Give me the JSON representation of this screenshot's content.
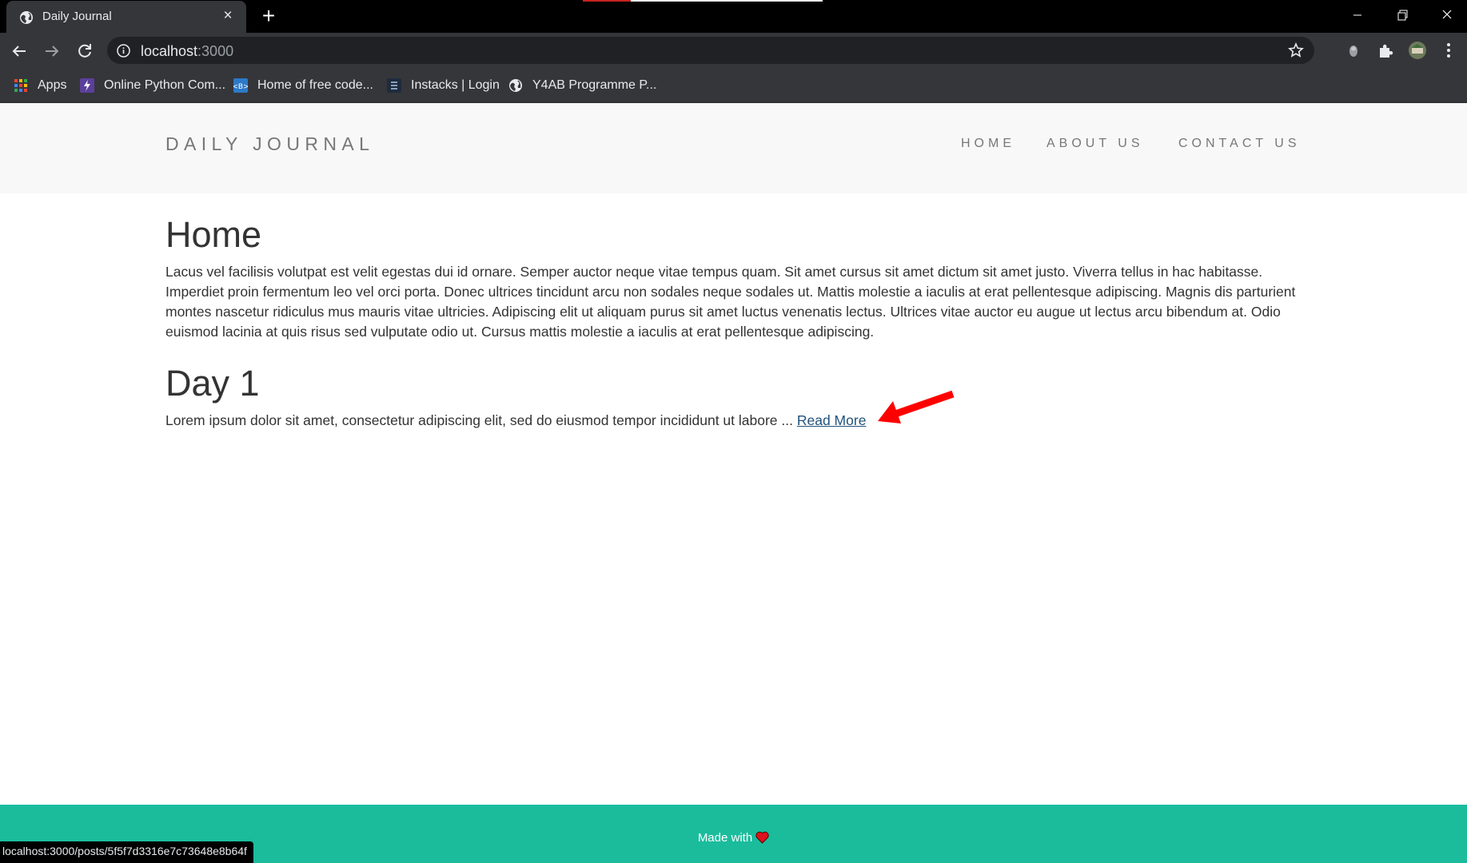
{
  "browser": {
    "tab": {
      "title": "Daily Journal",
      "favicon": "globe-icon",
      "close": "×"
    },
    "new_tab": "+",
    "window_controls": {
      "minimize": "minimize-icon",
      "maximize": "restore-icon",
      "close": "close-icon"
    },
    "address": {
      "host": "localhost",
      "port": ":3000"
    },
    "bookmarks": [
      {
        "label": "Apps",
        "icon": "apps-grid-icon"
      },
      {
        "label": "Online Python Com...",
        "icon": "lightning-icon"
      },
      {
        "label": "Home of free code...",
        "icon": "code-icon"
      },
      {
        "label": "Instacks | Login",
        "icon": "instacks-icon"
      },
      {
        "label": "Y4AB Programme P...",
        "icon": "globe-icon"
      }
    ],
    "status_url": "localhost:3000/posts/5f5f7d3316e7c73648e8b64f"
  },
  "site": {
    "brand": "DAILY JOURNAL",
    "nav": {
      "home": "HOME",
      "about": "ABOUT US",
      "contact": "CONTACT US"
    }
  },
  "page": {
    "heading": "Home",
    "text": "Lacus vel facilisis volutpat est velit egestas dui id ornare. Semper auctor neque vitae tempus quam. Sit amet cursus sit amet dictum sit amet justo. Viverra tellus in hac habitasse. Imperdiet proin fermentum leo vel orci porta. Donec ultrices tincidunt arcu non sodales neque sodales ut. Mattis molestie a iaculis at erat pellentesque adipiscing. Magnis dis parturient montes nascetur ridiculus mus mauris vitae ultricies. Adipiscing elit ut aliquam purus sit amet luctus venenatis lectus. Ultrices vitae auctor eu augue ut lectus arcu bibendum at. Odio euismod lacinia at quis risus sed vulputate odio ut. Cursus mattis molestie a iaculis at erat pellentesque adipiscing."
  },
  "posts": [
    {
      "title": "Day 1",
      "excerpt": "Lorem ipsum dolor sit amet, consectetur adipiscing elit, sed do eiusmod tempor incididunt ut labore ...",
      "read_more": "Read More"
    }
  ],
  "footer": {
    "text": "Made with"
  },
  "colors": {
    "footer_bg": "#1abc9c",
    "header_bg": "#f8f8f8",
    "link": "#23527c",
    "annotation_arrow": "#ff0000",
    "heart": "#e0101a"
  }
}
